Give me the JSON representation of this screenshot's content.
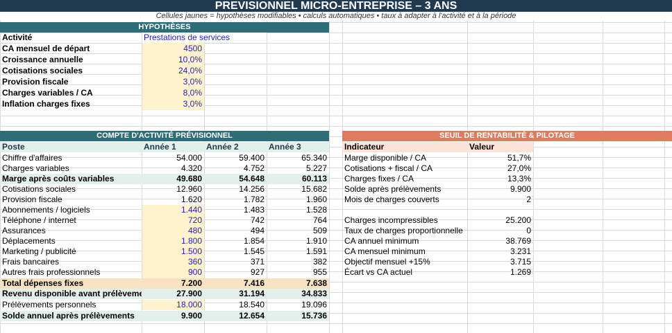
{
  "header": {
    "title": "PREVISIONNEL MICRO-ENTREPRISE – 3 ANS",
    "subtitle": "Cellules jaunes = hypothèses modifiables • calculs automatiques • taux à adapter à l'activité et à la période"
  },
  "hypotheses": {
    "heading": "HYPOTHÈSES",
    "rows": [
      {
        "label": "Activité",
        "value": "Prestations de services"
      },
      {
        "label": "CA mensuel de départ",
        "value": "4500"
      },
      {
        "label": "Croissance annuelle",
        "value": "10,0%"
      },
      {
        "label": "Cotisations sociales",
        "value": "24,0%"
      },
      {
        "label": "Provision fiscale",
        "value": "3,0%"
      },
      {
        "label": "Charges variables / CA",
        "value": "8,0%"
      },
      {
        "label": "Inflation charges fixes",
        "value": "3,0%"
      }
    ]
  },
  "compte": {
    "heading": "COMPTE D'ACTIVITÉ PRÉVISIONNEL",
    "columns": [
      "Poste",
      "Année 1",
      "Année 2",
      "Année 3"
    ],
    "rows": [
      {
        "label": "Chiffre d'affaires",
        "y1": "54.000",
        "y2": "59.400",
        "y3": "65.340"
      },
      {
        "label": "Charges variables",
        "y1": "4.320",
        "y2": "4.752",
        "y3": "5.227"
      },
      {
        "label": "Marge après coûts variables",
        "y1": "49.680",
        "y2": "54.648",
        "y3": "60.113"
      },
      {
        "label": "Cotisations sociales",
        "y1": "12.960",
        "y2": "14.256",
        "y3": "15.682"
      },
      {
        "label": "Provision fiscale",
        "y1": "1.620",
        "y2": "1.782",
        "y3": "1.960"
      },
      {
        "label": "Abonnements / logiciels",
        "y1": "1.440",
        "y2": "1.483",
        "y3": "1.528"
      },
      {
        "label": "Téléphone / internet",
        "y1": "720",
        "y2": "742",
        "y3": "764"
      },
      {
        "label": "Assurances",
        "y1": "480",
        "y2": "494",
        "y3": "509"
      },
      {
        "label": "Déplacements",
        "y1": "1.800",
        "y2": "1.854",
        "y3": "1.910"
      },
      {
        "label": "Marketing / publicité",
        "y1": "1.500",
        "y2": "1.545",
        "y3": "1.591"
      },
      {
        "label": "Frais bancaires",
        "y1": "360",
        "y2": "371",
        "y3": "382"
      },
      {
        "label": "Autres frais professionnels",
        "y1": "900",
        "y2": "927",
        "y3": "955"
      },
      {
        "label": "Total dépenses fixes",
        "y1": "7.200",
        "y2": "7.416",
        "y3": "7.638"
      },
      {
        "label": "Revenu disponible avant prélèvemei",
        "y1": "27.900",
        "y2": "31.194",
        "y3": "34.833"
      },
      {
        "label": "Prélèvements personnels",
        "y1": "18.000",
        "y2": "18.540",
        "y3": "19.096"
      },
      {
        "label": "Solde annuel après prélèvements",
        "y1": "9.900",
        "y2": "12.654",
        "y3": "15.736"
      }
    ]
  },
  "seuil": {
    "heading": "SEUIL DE RENTABILITÉ & PILOTAGE",
    "columns": [
      "Indicateur",
      "Valeur"
    ],
    "rows": [
      {
        "label": "Marge disponible / CA",
        "value": "51,7%"
      },
      {
        "label": "Cotisations + fiscal / CA",
        "value": "27,0%"
      },
      {
        "label": "Charges fixes / CA",
        "value": "13,3%"
      },
      {
        "label": "Solde après prélèvements",
        "value": "9.900"
      },
      {
        "label": "Mois de charges couverts",
        "value": "2"
      },
      {
        "label": "",
        "value": ""
      },
      {
        "label": "Charges incompressibles",
        "value": "25.200"
      },
      {
        "label": "Taux de charges proportionnelle",
        "value": "0"
      },
      {
        "label": "CA annuel minimum",
        "value": "38.769"
      },
      {
        "label": "CA mensuel minimum",
        "value": "3.231"
      },
      {
        "label": "Objectif mensuel +15%",
        "value": "3.715"
      },
      {
        "label": "Écart vs CA actuel",
        "value": "1.269"
      }
    ]
  }
}
